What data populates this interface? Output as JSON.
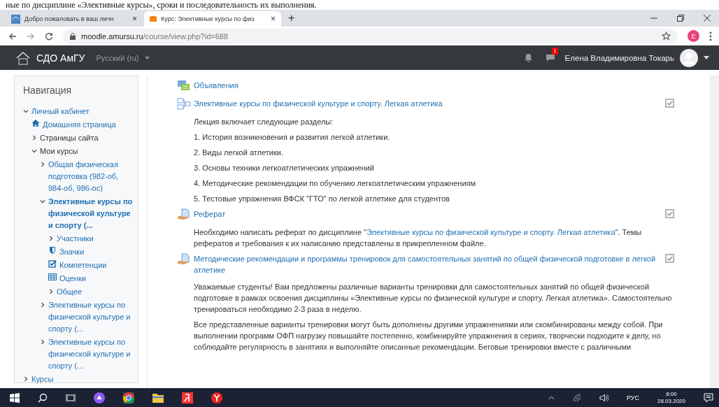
{
  "doc_fragment": "ные по дисциплине «Элективные курсы», сроки и последовательность их выполнения.",
  "browser": {
    "tabs": [
      {
        "title": "Добро пожаловать в ваш личн",
        "selected": false,
        "close": "×"
      },
      {
        "title": "Курс: Элективные курсы по физ",
        "selected": true,
        "close": "×"
      }
    ],
    "new_tab": "+",
    "url_host": "moodle.amursu.ru",
    "url_path": "/course/view.php?id=688",
    "profile_initial": "E"
  },
  "navbar": {
    "brand": "СДО АмГУ",
    "language": "Русский (ru)",
    "message_count": "1",
    "user_name": "Елена Владимировна Токарь"
  },
  "navigation": {
    "title": "Навигация",
    "items": [
      {
        "kind": "branch",
        "label": "Личный кабинет",
        "link": true,
        "expanded": true,
        "current": false,
        "children": [
          {
            "kind": "home",
            "label": "Домашняя страница",
            "link": true,
            "current": false
          },
          {
            "kind": "branch",
            "label": "Страницы сайта",
            "link": false,
            "expanded": false,
            "current": false
          },
          {
            "kind": "branch",
            "label": "Мои курсы",
            "link": false,
            "expanded": true,
            "current": false,
            "children": [
              {
                "kind": "branch",
                "label": "Общая физическая подготовка (982-об, 984-об, 986-ос)",
                "link": true,
                "expanded": false,
                "current": false
              },
              {
                "kind": "branch",
                "label": "Элективные курсы по физической культуре и спорту (...",
                "link": true,
                "expanded": true,
                "current": true,
                "children": [
                  {
                    "kind": "branch",
                    "label": "Участники",
                    "link": true,
                    "expanded": false,
                    "current": false
                  },
                  {
                    "kind": "badge",
                    "label": "Значки",
                    "link": true,
                    "current": false
                  },
                  {
                    "kind": "competency",
                    "label": "Компетенции",
                    "link": true,
                    "current": false
                  },
                  {
                    "kind": "grades",
                    "label": "Оценки",
                    "link": true,
                    "current": false
                  },
                  {
                    "kind": "branch",
                    "label": "Общее",
                    "link": true,
                    "expanded": false,
                    "current": false
                  }
                ]
              },
              {
                "kind": "branch",
                "label": "Элективные курсы по физической культуре и спорту (...",
                "link": true,
                "expanded": false,
                "current": false
              },
              {
                "kind": "branch",
                "label": "Элективные курсы по физической культуре и спорту (...",
                "link": true,
                "expanded": false,
                "current": false
              }
            ]
          }
        ]
      },
      {
        "kind": "branch",
        "label": "Курсы",
        "link": true,
        "expanded": false,
        "current": false
      }
    ]
  },
  "activities": [
    {
      "kind": "forum",
      "title": "Объявления"
    },
    {
      "kind": "folder",
      "title": "Элективные курсы по физической культуре и спорту. Легкая атлетика",
      "checked": true,
      "paragraphs": [
        {
          "text": "Лекция включает следующие разделы:"
        },
        {
          "text": "1. История возникновения и развития легкой атлетики."
        },
        {
          "text": "2. Виды легкой атлетики."
        },
        {
          "text": "3. Основы техники легкоатлетических упражнений"
        },
        {
          "text": "4. Методические рекомендации по обучению легкоатлетическим упражнениям"
        },
        {
          "text": "5. Тестовые упражнения ВФСК \"ГТО\" по легкой атлетике для студентов"
        }
      ]
    },
    {
      "kind": "assign",
      "title": "Реферат",
      "checked": true,
      "paragraphs": [
        {
          "before": "Необходимо написать реферат по дисциплине \"",
          "link": "Элективные курсы по физической культуре и спорту. Легкая атлетика",
          "after": "\". Темы рефератов и требования к их написанию представлены в прикрепленном файле."
        }
      ]
    },
    {
      "kind": "assign",
      "title": "Методические рекомендации и программы тренировок для самостоятельных занятий по общей физической подготовке в легкой атлетике",
      "checked": true,
      "paragraphs": [
        {
          "text": "Уважаемые студенты! Вам предложены различные варианты тренировки для самостоятельных занятий по общей физической подготовке в рамках освоения дисциплины «Элективные курсы по физической культуре и спорту. Легкая атлетика». Самостоятельно тренироваться необходимо 2-3 раза в неделю."
        },
        {
          "text": "Все представленные варианты тренировки могут быть дополнены другими упражнениями или скомбинированы между собой. При выполнении программ ОФП нагрузку повышайте постепенно, комбинируйте упражнения в сериях, творчески подходите к делу, но соблюдайте регулярность в занятиях и выполняйте описанные рекомендации. Беговые тренировки вместе с различными"
        }
      ]
    }
  ],
  "taskbar": {
    "language": "РУС",
    "time": "8:00",
    "date": "28.03.2020"
  }
}
